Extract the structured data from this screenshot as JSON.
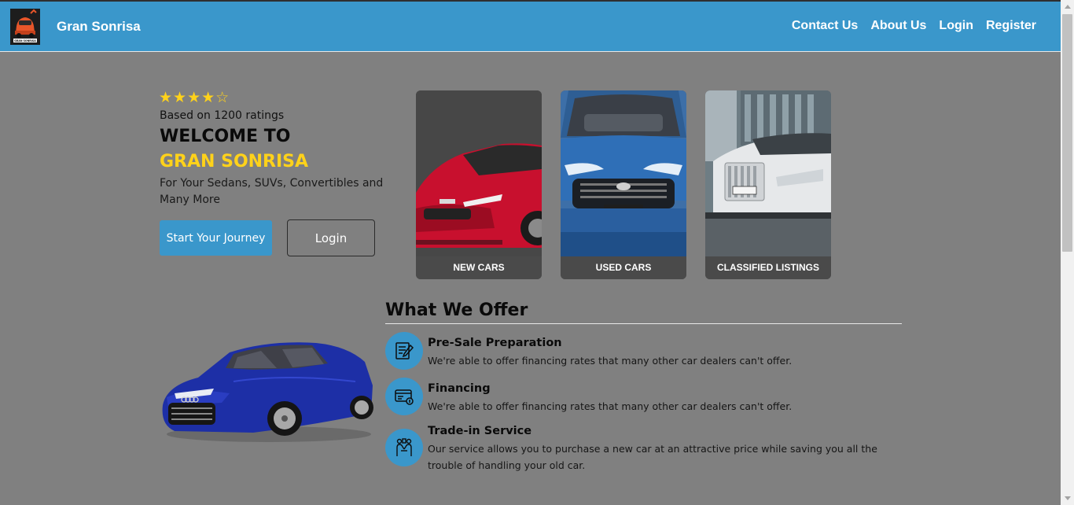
{
  "header": {
    "brand": "Gran Sonrisa",
    "logo_text": "GRAN SONRISA",
    "nav": [
      "Contact Us",
      "About Us",
      "Login",
      "Register"
    ]
  },
  "hero": {
    "rating_stars": "★★★★☆",
    "rating_value": 4,
    "rating_max": 5,
    "rating_text": "Based on 1200 ratings",
    "welcome": "WELCOME TO",
    "brand_title": "GRAN SONRISA",
    "tagline": "For Your Sedans, SUVs, Convertibles and Many More",
    "primary_button": "Start Your Journey",
    "secondary_button": "Login"
  },
  "cards": [
    {
      "label": "NEW CARS"
    },
    {
      "label": "USED CARS"
    },
    {
      "label": "CLASSIFIED LISTINGS"
    }
  ],
  "offer": {
    "title": "What We Offer",
    "items": [
      {
        "title": "Pre-Sale Preparation",
        "desc": "We're able to offer financing rates that many other car dealers can't offer.",
        "icon": "document-edit-icon"
      },
      {
        "title": "Financing",
        "desc": "We're able to offer financing rates that many other car dealers can't offer.",
        "icon": "payment-card-icon"
      },
      {
        "title": "Trade-in Service",
        "desc": "Our service allows you to purchase a new car at an attractive price while saving you all the trouble of handling your old car.",
        "icon": "handshake-people-icon"
      }
    ]
  },
  "colors": {
    "header": "#3a97cb",
    "accent_yellow": "#ffd21a",
    "page_bg": "#808080",
    "card_bg": "#474747"
  }
}
